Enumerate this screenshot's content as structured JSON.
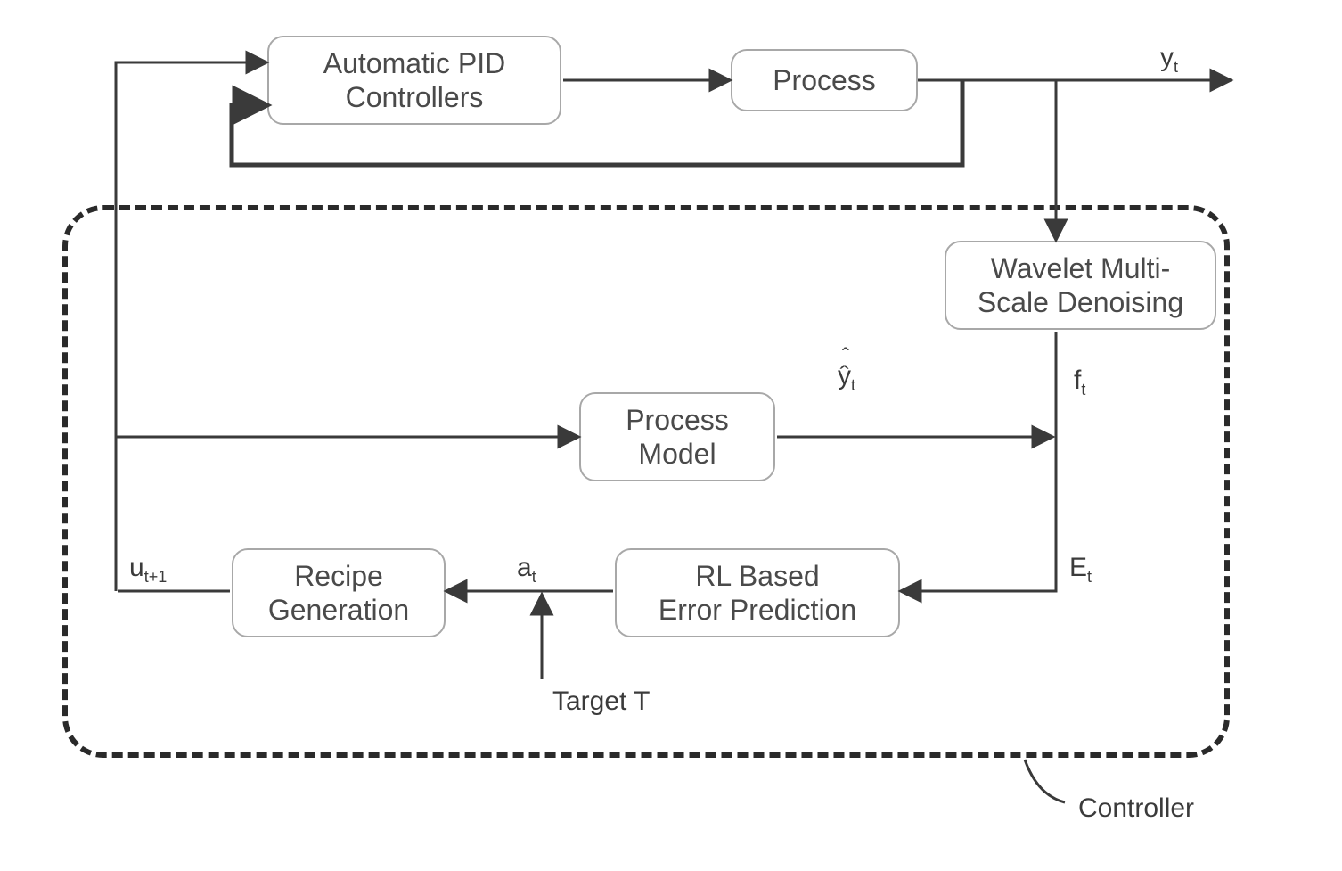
{
  "boxes": {
    "pid": "Automatic PID\nControllers",
    "process": "Process",
    "wavelet": "Wavelet Multi-\nScale Denoising",
    "processModel": "Process\nModel",
    "rlError": "RL Based\nError  Prediction",
    "recipe": "Recipe\nGeneration"
  },
  "labels": {
    "yt": "y",
    "yt_sub": "t",
    "yhat": "ŷ",
    "yhat_sub": "t",
    "ft": "f",
    "ft_sub": "t",
    "Et": "E",
    "Et_sub": "t",
    "ut1": "u",
    "ut1_sub": "t+1",
    "at": "a",
    "at_sub": "t",
    "target": "Target T",
    "controller": "Controller",
    "hat_glyph": "ˆ"
  },
  "arrows": {
    "stroke": "#3a3a3a"
  }
}
